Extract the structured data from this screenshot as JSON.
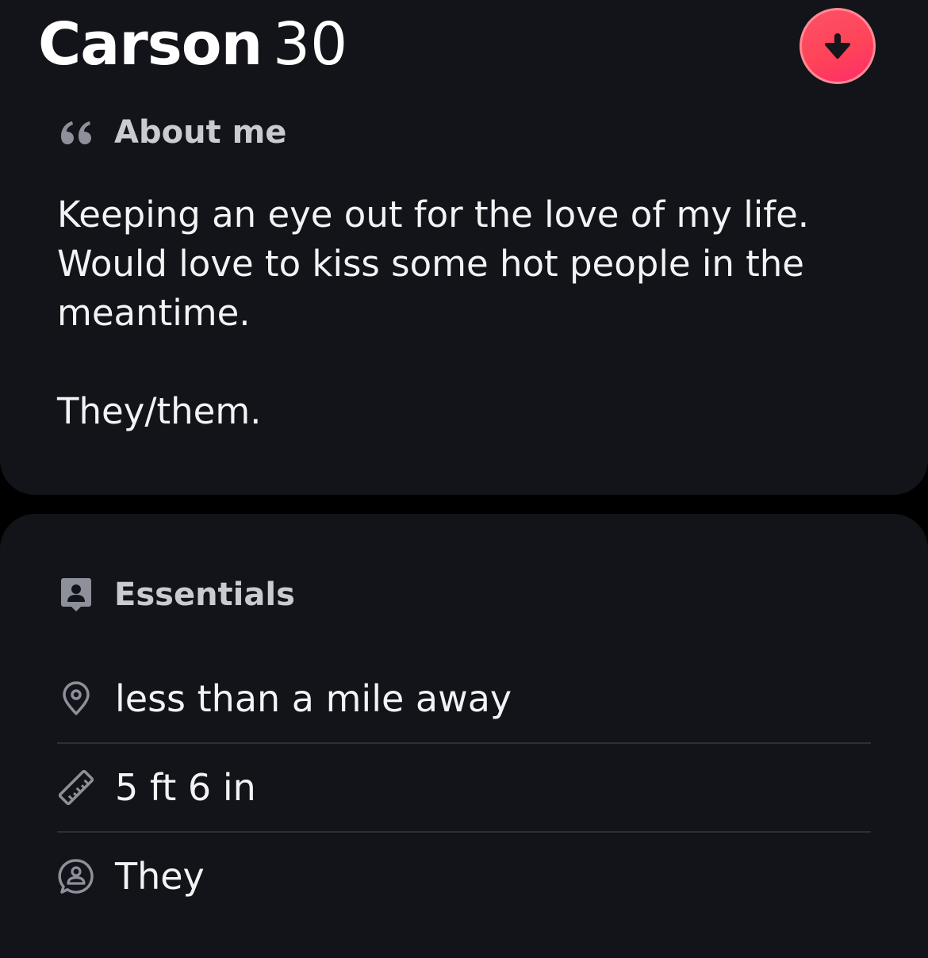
{
  "profile": {
    "name": "Carson",
    "age": "30"
  },
  "about": {
    "icon": "quote-icon",
    "title": "About me",
    "bio_lines": [
      "Keeping an eye out for the love of my life.",
      "Would love to kiss some hot people in the",
      "meantime."
    ],
    "pronoun_line": "They/them."
  },
  "essentials": {
    "icon": "id-badge-icon",
    "title": "Essentials",
    "items": [
      {
        "icon": "location-pin-icon",
        "text": "less than a mile away"
      },
      {
        "icon": "ruler-icon",
        "text": "5 ft 6 in"
      },
      {
        "icon": "pronoun-person-icon",
        "text": "They"
      }
    ]
  },
  "colors": {
    "accent": "#fd5068",
    "card_background": "#121419",
    "page_background": "#000000",
    "muted_text": "#c9cbd2"
  }
}
